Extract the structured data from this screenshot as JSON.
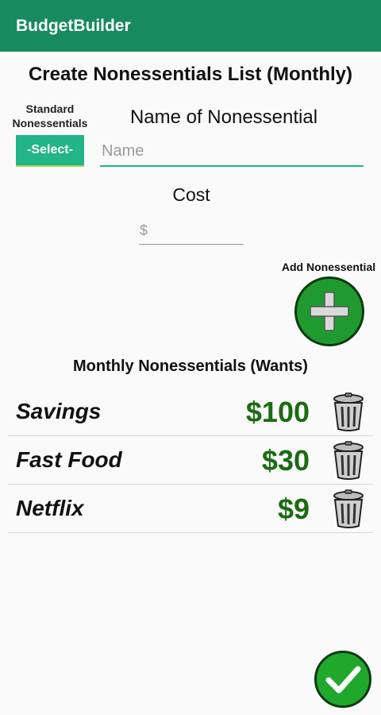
{
  "app": {
    "title": "BudgetBuilder"
  },
  "page": {
    "title": "Create Nonessentials List (Monthly)"
  },
  "form": {
    "standard_label": "Standard Nonessentials",
    "select_label": "-Select-",
    "name_label": "Name of Nonessential",
    "name_placeholder": "Name",
    "cost_label": "Cost",
    "cost_placeholder": "$",
    "add_label": "Add Nonessential"
  },
  "list": {
    "heading": "Monthly Nonessentials (Wants)",
    "items": [
      {
        "name": "Savings",
        "amount": "$100"
      },
      {
        "name": "Fast Food",
        "amount": "$30"
      },
      {
        "name": "Netflix",
        "amount": "$9"
      }
    ]
  },
  "icons": {
    "add": "plus-icon",
    "delete": "trash-icon",
    "done": "checkmark-icon"
  },
  "colors": {
    "appbar": "#178a5e",
    "accent": "#21b587",
    "amount": "#1b6b12",
    "button_green": "#1f9a2f"
  }
}
